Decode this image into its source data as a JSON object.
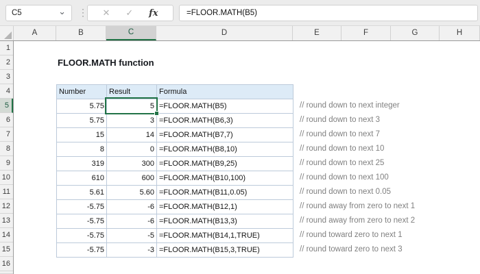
{
  "formula_bar": {
    "name_box": "C5",
    "formula": "=FLOOR.MATH(B5)",
    "cancel_icon": "✕",
    "enter_icon": "✓",
    "fx_label": "fx"
  },
  "title": "FLOOR.MATH function",
  "grid": {
    "column_headers": [
      "A",
      "B",
      "C",
      "D",
      "E",
      "F",
      "G",
      "H"
    ],
    "selected_column": "C",
    "row_headers": [
      "1",
      "2",
      "3",
      "4",
      "5",
      "6",
      "7",
      "8",
      "9",
      "10",
      "11",
      "12",
      "13",
      "14",
      "15",
      "16"
    ],
    "selected_row": "5",
    "selected_cell": "C5"
  },
  "table": {
    "headers": [
      "Number",
      "Result",
      "Formula"
    ],
    "rows": [
      {
        "number": "5.75",
        "result": "5",
        "formula": "=FLOOR.MATH(B5)",
        "comment": "// round down to next integer"
      },
      {
        "number": "5.75",
        "result": "3",
        "formula": "=FLOOR.MATH(B6,3)",
        "comment": "// round down to next 3"
      },
      {
        "number": "15",
        "result": "14",
        "formula": "=FLOOR.MATH(B7,7)",
        "comment": "// round down to next 7"
      },
      {
        "number": "8",
        "result": "0",
        "formula": "=FLOOR.MATH(B8,10)",
        "comment": "// round down to next 10"
      },
      {
        "number": "319",
        "result": "300",
        "formula": "=FLOOR.MATH(B9,25)",
        "comment": "// round down to next 25"
      },
      {
        "number": "610",
        "result": "600",
        "formula": "=FLOOR.MATH(B10,100)",
        "comment": "// round down to next 100"
      },
      {
        "number": "5.61",
        "result": "5.60",
        "formula": "=FLOOR.MATH(B11,0.05)",
        "comment": "// round down to next 0.05"
      },
      {
        "number": "-5.75",
        "result": "-6",
        "formula": "=FLOOR.MATH(B12,1)",
        "comment": "// round away from zero to next 1"
      },
      {
        "number": "-5.75",
        "result": "-6",
        "formula": "=FLOOR.MATH(B13,3)",
        "comment": "// round away from zero to next 2"
      },
      {
        "number": "-5.75",
        "result": "-5",
        "formula": "=FLOOR.MATH(B14,1,TRUE)",
        "comment": "// round toward zero to next 1"
      },
      {
        "number": "-5.75",
        "result": "-3",
        "formula": "=FLOOR.MATH(B15,3,TRUE)",
        "comment": "// round toward zero to next 3"
      }
    ]
  },
  "colors": {
    "accent_green": "#217346",
    "header_fill": "#DDEBF7",
    "table_border": "#bccada",
    "comment_gray": "#808080"
  }
}
